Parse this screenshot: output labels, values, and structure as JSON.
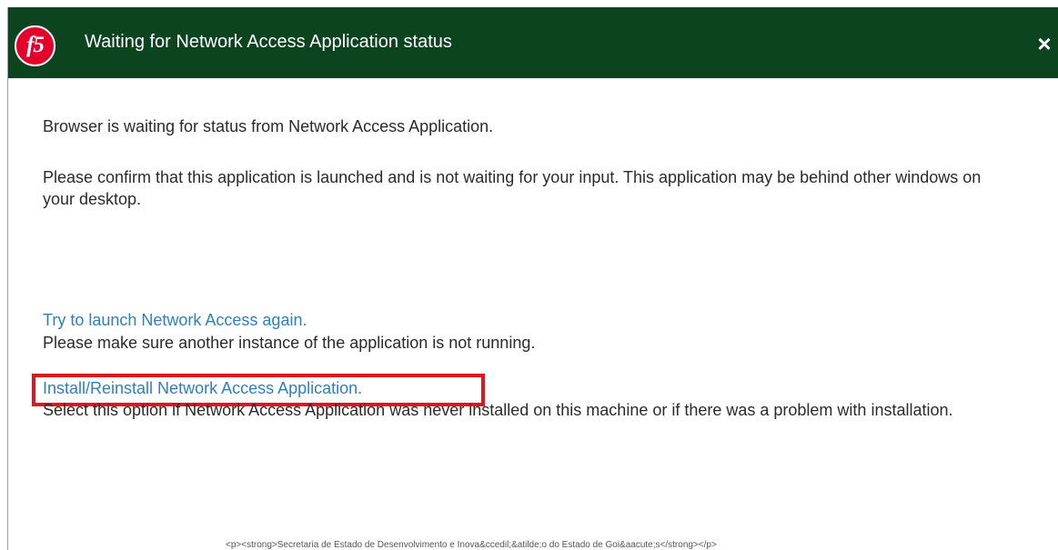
{
  "dialog": {
    "title": "Waiting for Network Access Application status",
    "logo_text": "f5",
    "close_label": "×"
  },
  "content": {
    "paragraph1": "Browser is waiting for status from Network Access Application.",
    "paragraph2": "Please confirm that this application is launched and is not waiting for your input. This application may be behind other windows on your desktop.",
    "relaunch_link": "Try to launch Network Access again.",
    "relaunch_note": "Please make sure another instance of the application is not running.",
    "install_link": "Install/Reinstall Network Access Application.",
    "install_note": "Select this option if Network Access Application was never installed on this machine or if there was a problem with installation."
  },
  "footer": {
    "text": "<p><strong>Secretaria de Estado de Desenvolvimento e Inova&ccedil;&atilde;o do Estado de Goi&aacute;s</strong></p>"
  },
  "colors": {
    "titlebar": "#0d4420",
    "link": "#2e7fc2",
    "highlight": "#e0161e",
    "logo": "#e4002b"
  }
}
